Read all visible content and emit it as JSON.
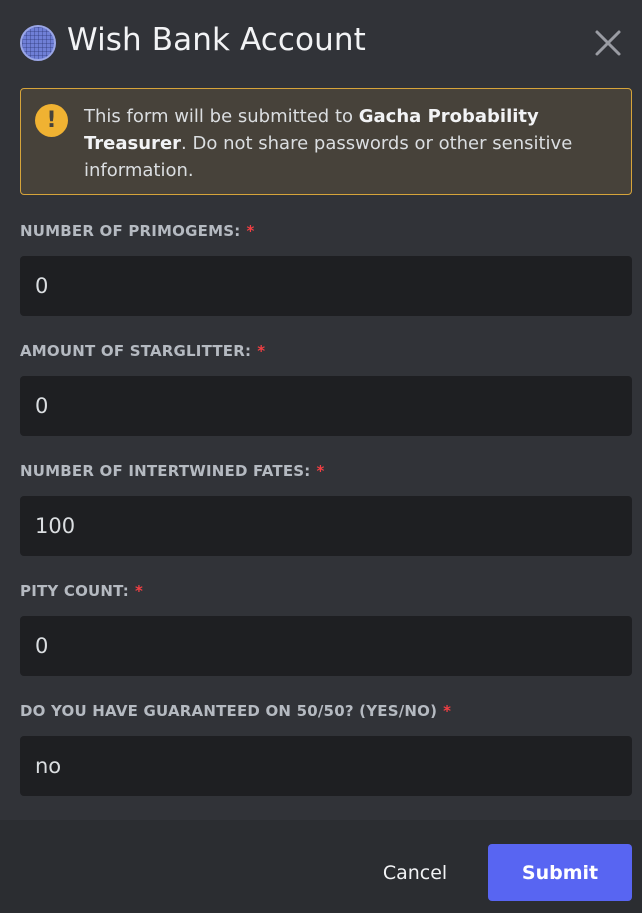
{
  "header": {
    "title": "Wish Bank Account",
    "app_icon": "app-avatar-icon",
    "close_icon": "close-icon"
  },
  "notice": {
    "icon": "warning-icon",
    "icon_glyph": "!",
    "text_before": "This form will be submitted to ",
    "app_name": "Gacha Probability Treasurer",
    "text_after": ". Do not share passwords or other sensitive information."
  },
  "fields": [
    {
      "label": "NUMBER OF PRIMOGEMS:",
      "required_mark": "*",
      "value": "0"
    },
    {
      "label": "AMOUNT OF STARGLITTER:",
      "required_mark": "*",
      "value": "0"
    },
    {
      "label": "NUMBER OF INTERTWINED FATES:",
      "required_mark": "*",
      "value": "100"
    },
    {
      "label": "PITY COUNT:",
      "required_mark": "*",
      "value": "0"
    },
    {
      "label": "DO YOU HAVE GUARANTEED ON 50/50? (YES/NO)",
      "required_mark": "*",
      "value": "no"
    }
  ],
  "footer": {
    "cancel_label": "Cancel",
    "submit_label": "Submit"
  },
  "colors": {
    "background": "#313338",
    "input_background": "#1e1f22",
    "accent": "#5865f2",
    "warning": "#f0b232",
    "required": "#f23f43"
  }
}
